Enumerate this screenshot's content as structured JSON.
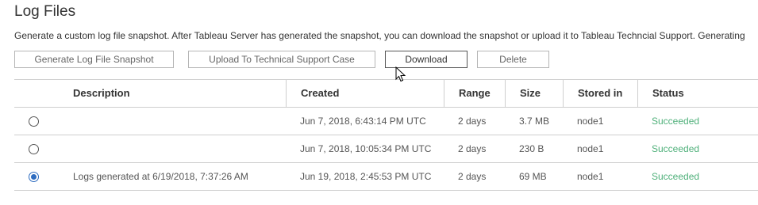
{
  "header": {
    "title": "Log Files",
    "description": "Generate a custom log file snapshot. After Tableau Server has generated the snapshot, you can download the snapshot or upload it to Tableau Techncial Support. Generating"
  },
  "toolbar": {
    "generate_label": "Generate Log File Snapshot",
    "upload_label": "Upload To Technical Support Case",
    "download_label": "Download",
    "delete_label": "Delete"
  },
  "table": {
    "columns": {
      "description": "Description",
      "created": "Created",
      "range": "Range",
      "size": "Size",
      "stored_in": "Stored in",
      "status": "Status"
    },
    "rows": [
      {
        "selected": false,
        "description": "",
        "created": "Jun 7, 2018, 6:43:14 PM UTC",
        "range": "2 days",
        "size": "3.7 MB",
        "stored_in": "node1",
        "status": "Succeeded"
      },
      {
        "selected": false,
        "description": "",
        "created": "Jun 7, 2018, 10:05:34 PM UTC",
        "range": "2 days",
        "size": "230 B",
        "stored_in": "node1",
        "status": "Succeeded"
      },
      {
        "selected": true,
        "description": "Logs generated at 6/19/2018, 7:37:26 AM",
        "created": "Jun 19, 2018, 2:45:53 PM UTC",
        "range": "2 days",
        "size": "69 MB",
        "stored_in": "node1",
        "status": "Succeeded"
      }
    ]
  },
  "colors": {
    "status_success": "#4fb07a",
    "radio_selected": "#2d6cc0",
    "border": "#cfcfcf"
  },
  "icons": {
    "cursor": "mouse-pointer-icon"
  }
}
